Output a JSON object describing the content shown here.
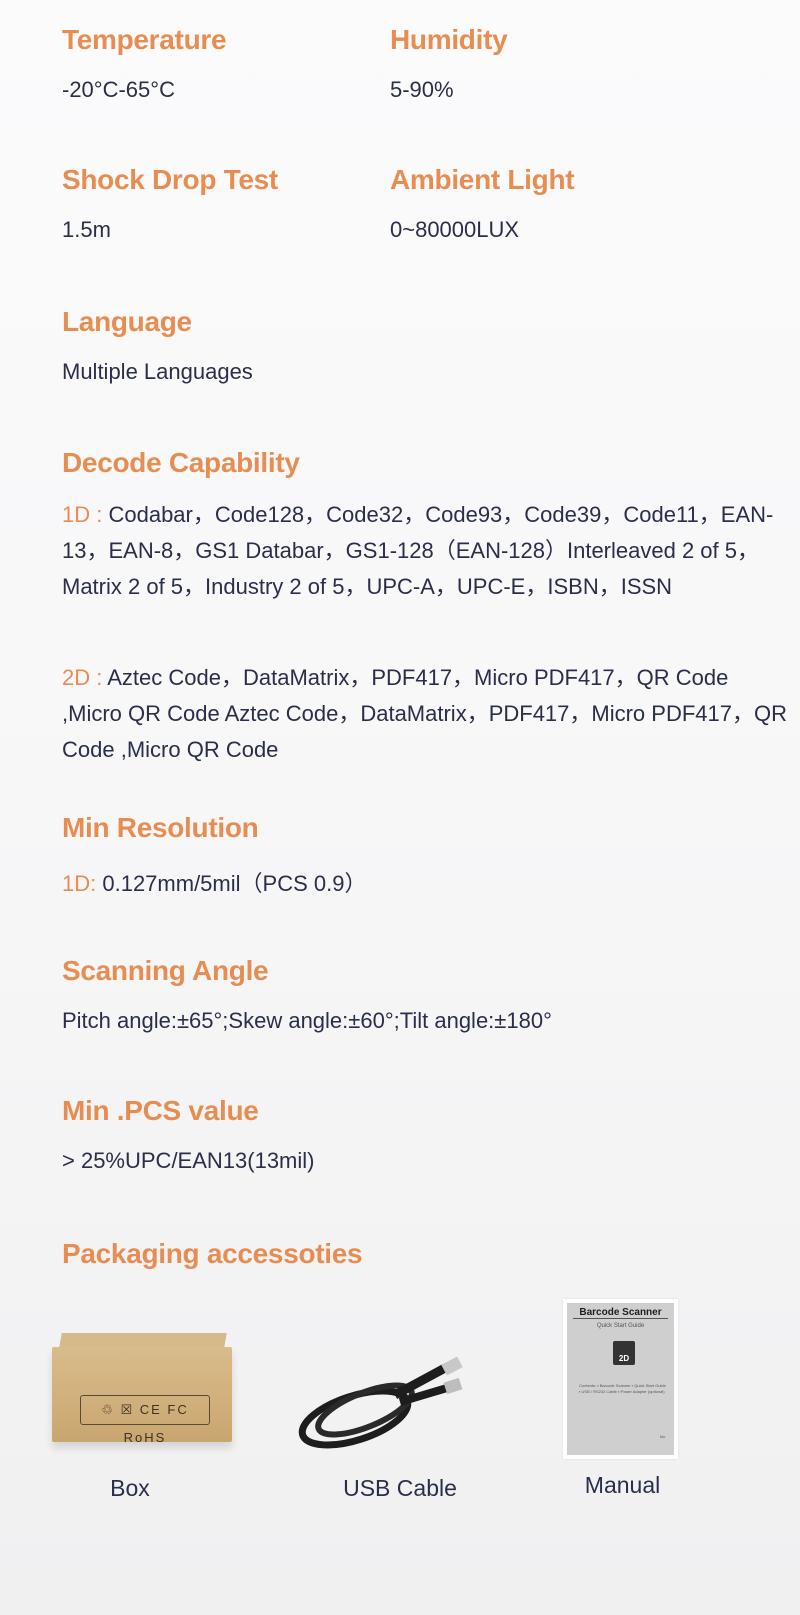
{
  "specs": {
    "temperature": {
      "label": "Temperature",
      "value": "-20°C-65°C"
    },
    "humidity": {
      "label": "Humidity",
      "value": "5-90%"
    },
    "shock_drop": {
      "label": "Shock Drop Test",
      "value": "1.5m"
    },
    "ambient_light": {
      "label": "Ambient Light",
      "value": "0~80000LUX"
    },
    "language": {
      "label": "Language",
      "value": "Multiple Languages"
    },
    "decode": {
      "label": "Decode Capability",
      "d1_prefix": "1D :",
      "d1_text": " Codabar，Code128，Code32，Code93，Code39，Code11，EAN-13，EAN-8，GS1 Databar，GS1-128（EAN-128）Interleaved 2 of 5，Matrix 2 of 5，Industry 2 of 5，UPC-A，UPC-E，ISBN，ISSN",
      "d2_prefix": "2D :",
      "d2_text": " Aztec Code，DataMatrix，PDF417，Micro PDF417，QR Code ,Micro QR Code Aztec Code，DataMatrix，PDF417，Micro PDF417，QR Code ,Micro QR Code"
    },
    "min_resolution": {
      "label": "Min Resolution",
      "prefix": "1D:",
      "value": " 0.127mm/5mil（PCS 0.9）"
    },
    "scanning_angle": {
      "label": "Scanning Angle",
      "value": "Pitch angle:±65°;Skew angle:±60°;Tilt angle:±180°"
    },
    "min_pcs": {
      "label": "Min .PCS value",
      "value": "> 25%UPC/EAN13(13mil)"
    }
  },
  "packaging": {
    "label": "Packaging accessoties",
    "items": [
      {
        "caption": "Box",
        "print": "♲ ☒ CE FC RoHS"
      },
      {
        "caption": "USB Cable"
      },
      {
        "caption": "Manual",
        "doc_title": "Barcode Scanner",
        "doc_subtitle": "Quick Start Guide",
        "doc_badge": "2D",
        "doc_contents": "Contents: ▪ Barcode Scanner ▪ Quick Start Guide ▪ USB / RS232 Cable ▪ Power Adapter (optional)",
        "doc_footer": "No."
      }
    ]
  },
  "colors": {
    "accent": "#e88d52",
    "text": "#2b2e4a"
  }
}
